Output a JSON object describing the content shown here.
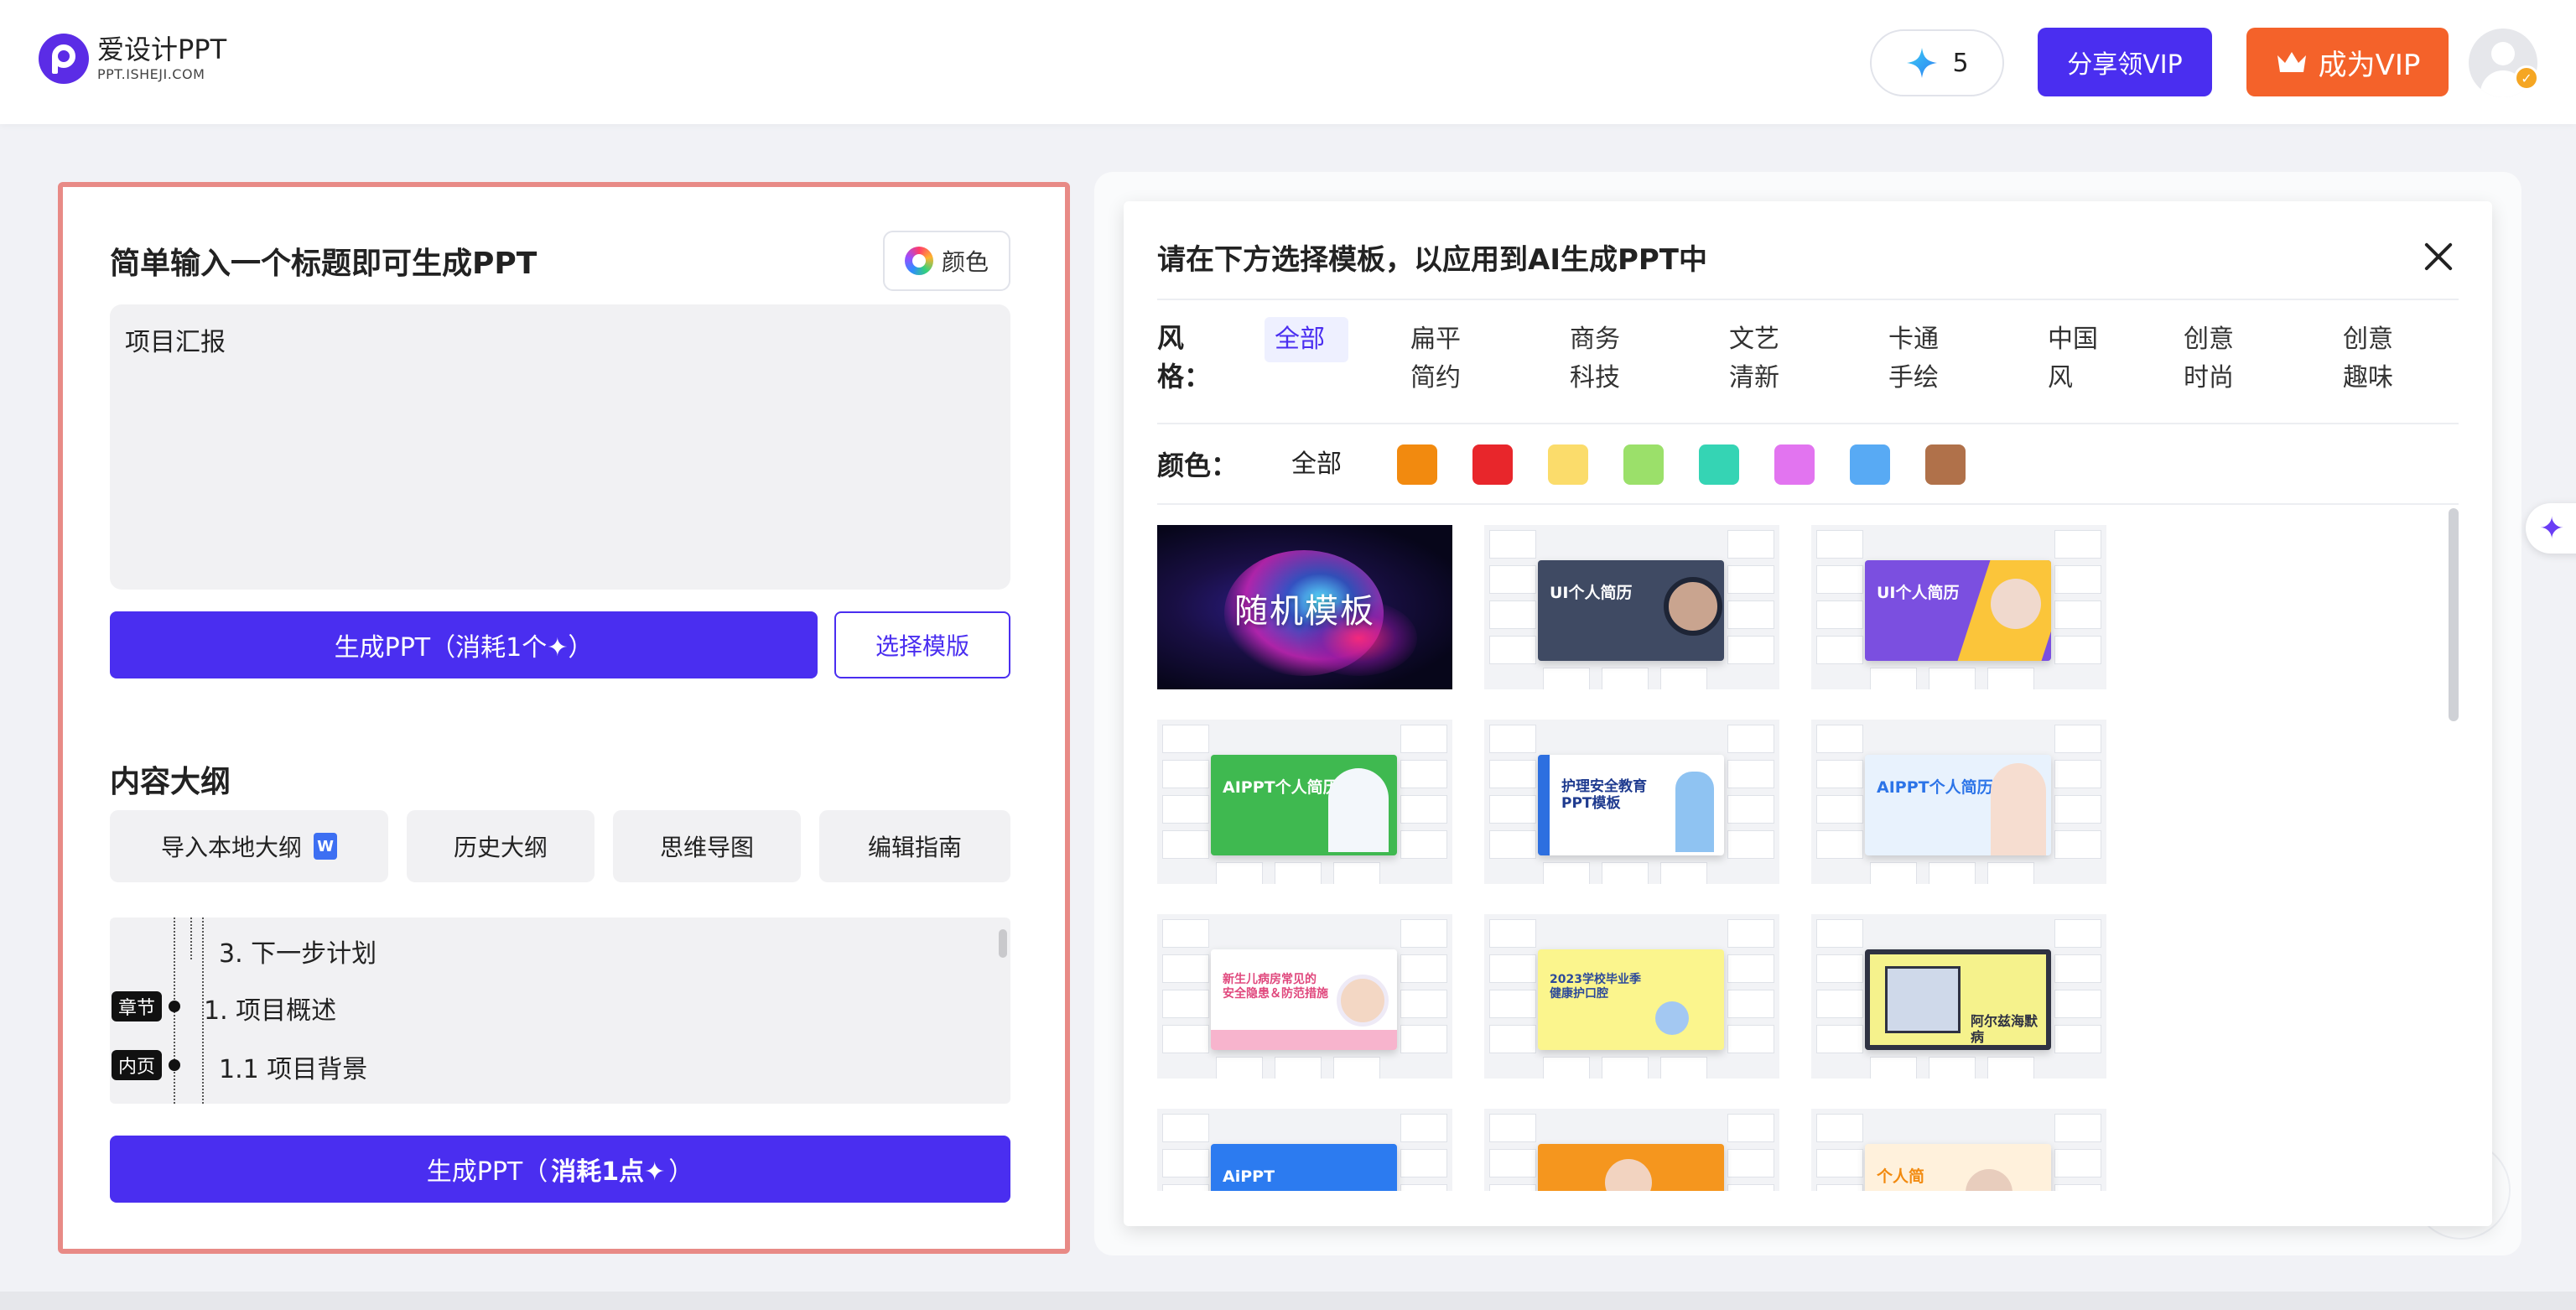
{
  "header": {
    "logo_title": "爱设计PPT",
    "logo_sub": "PPT.ISHEJI.COM",
    "credits": "5",
    "share_vip": "分享领VIP",
    "become_vip": "成为VIP"
  },
  "left": {
    "title": "简单输入一个标题即可生成PPT",
    "color_button": "颜色",
    "title_input_value": "项目汇报",
    "generate_button": "生成PPT（消耗1个✦）",
    "select_template_button": "选择模版",
    "outline_title": "内容大纲",
    "outline_tabs": [
      "导入本地大纲",
      "历史大纲",
      "思维导图",
      "编辑指南"
    ],
    "outline_items": [
      {
        "text": "3. 下一步计划",
        "tag": ""
      },
      {
        "text": "1. 项目概述",
        "tag": "章节"
      },
      {
        "text": "1.1 项目背景",
        "tag": "内页"
      }
    ],
    "generate_button2_prefix": "生成PPT（",
    "generate_button2_bold": "消耗1点✦",
    "generate_button2_suffix": "）"
  },
  "modal": {
    "title": "请在下方选择模板，以应用到AI生成PPT中",
    "style_label": "风格：",
    "styles": [
      "全部",
      "扁平简约",
      "商务科技",
      "文艺清新",
      "卡通手绘",
      "中国风",
      "创意时尚",
      "创意趣味"
    ],
    "active_style": "全部",
    "color_label": "颜色：",
    "color_all": "全部",
    "colors": [
      "#f28a0f",
      "#e8262b",
      "#fbdc6b",
      "#9be06a",
      "#35d4b4",
      "#e274f0",
      "#58aaf4",
      "#b0714a"
    ],
    "templates": [
      {
        "title": "随机模板",
        "theme": "random"
      },
      {
        "title": "UI个人简历",
        "theme": "#3f4a63"
      },
      {
        "title": "UI个人简历",
        "theme": "#7b4fe0"
      },
      {
        "title": "AIPPT个人简历",
        "theme": "#3fb950"
      },
      {
        "title": "护理安全教育\nPPT模板",
        "theme": "#2d6fe0"
      },
      {
        "title": "AIPPT个人简历",
        "theme": "#5aa0f0"
      },
      {
        "title": "新生儿病房常见的\n安全隐患＆防范措施",
        "theme": "#f07aa6"
      },
      {
        "title": "2023学校毕业季\n健康护口腔",
        "theme": "#f6ee7a"
      },
      {
        "title": "阿尔兹海默病",
        "theme": "#eaef86"
      },
      {
        "title": "AiPPT",
        "theme": "#2c7bf0"
      },
      {
        "title": "",
        "theme": "#f5961e"
      },
      {
        "title": "个人简",
        "theme": "#f7a33c"
      }
    ]
  }
}
